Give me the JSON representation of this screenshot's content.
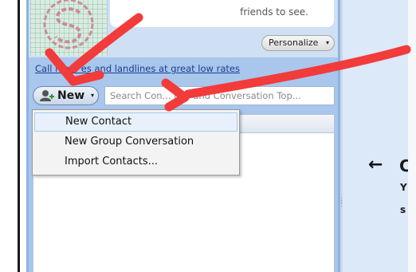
{
  "profile": {
    "mood_text": "friends to see.",
    "personalize_label": "Personalize",
    "personalize_arrow": "▾"
  },
  "promo": {
    "call_link": "Call mo... es and landlines at great low rates"
  },
  "toolbar": {
    "new_label": "New",
    "new_caret": "▾",
    "search_text": "Search Con... ups and Conversation Top..."
  },
  "new_menu": {
    "items": [
      "New Contact",
      "New Group Conversation",
      "Import Contacts..."
    ],
    "highlighted": "New Contact"
  },
  "right_pane": {
    "arrow": "←",
    "heading": "C",
    "line1": "Y",
    "line2": "s"
  },
  "annotation": {
    "stroke_color": "#f23b3b"
  },
  "colors": {
    "sidebar": "#a9c6ec",
    "right_pane": "#dce9f8"
  }
}
